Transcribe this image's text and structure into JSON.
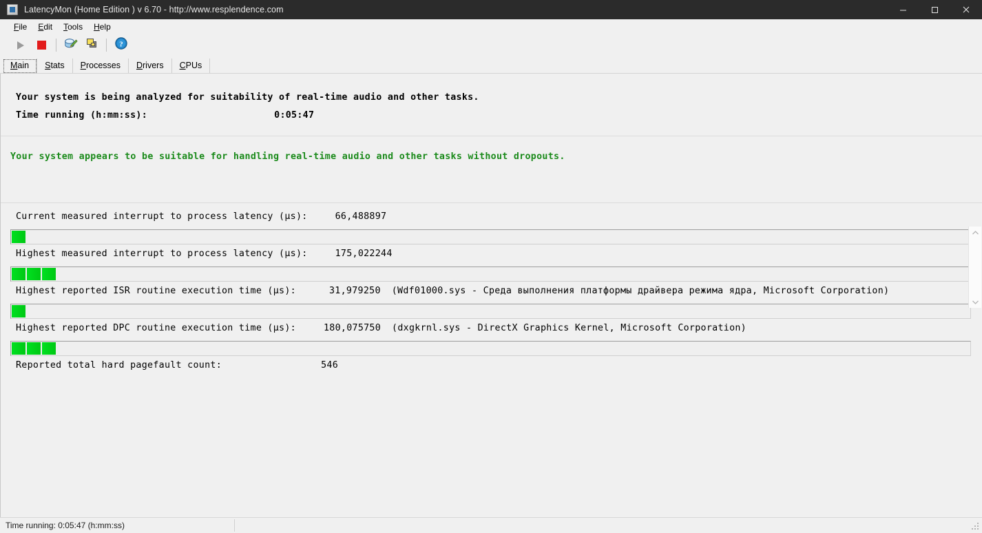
{
  "window": {
    "title": "LatencyMon  (Home Edition )  v 6.70 - http://www.resplendence.com",
    "icon": "app-icon",
    "minimize": "minimize-icon",
    "maximize": "maximize-icon",
    "close": "close-icon"
  },
  "menu": [
    {
      "label": "File",
      "accel": "F"
    },
    {
      "label": "Edit",
      "accel": "E"
    },
    {
      "label": "Tools",
      "accel": "T"
    },
    {
      "label": "Help",
      "accel": "H"
    }
  ],
  "toolbar": [
    {
      "name": "start-monitoring-button",
      "icon": "play-icon",
      "disabled": true
    },
    {
      "name": "stop-monitoring-button",
      "icon": "stop-icon",
      "disabled": false
    },
    {
      "name": "report-button",
      "icon": "report-pencil-icon",
      "disabled": false
    },
    {
      "name": "copy-button",
      "icon": "copy-windows-icon",
      "disabled": false
    },
    {
      "name": "help-button",
      "icon": "help-question-icon",
      "disabled": false
    }
  ],
  "tabs": [
    {
      "label": "Main",
      "accel": "M",
      "selected": true
    },
    {
      "label": "Stats",
      "accel": "S",
      "selected": false
    },
    {
      "label": "Processes",
      "accel": "P",
      "selected": false
    },
    {
      "label": "Drivers",
      "accel": "D",
      "selected": false
    },
    {
      "label": "CPUs",
      "accel": "C",
      "selected": false
    }
  ],
  "header": {
    "analysis_line": "Your system is being analyzed for suitability of real-time audio and other tasks.",
    "time_running_label": "Time running (h:mm:ss):",
    "time_running_value": "0:05:47"
  },
  "status": {
    "verdict": "Your system appears to be suitable for handling real-time audio and other tasks without dropouts.",
    "verdict_color": "#1a8a1a",
    "scroll_up": "chevron-up-icon",
    "scroll_down": "chevron-down-icon"
  },
  "metrics": [
    {
      "name": "current-interrupt-to-process-latency",
      "label": "Current measured interrupt to process latency (µs):",
      "value": "66,488897",
      "extra": "",
      "segments": 1
    },
    {
      "name": "highest-interrupt-to-process-latency",
      "label": "Highest measured interrupt to process latency (µs):",
      "value": "175,022244",
      "extra": "",
      "segments": 3
    },
    {
      "name": "highest-isr-routine-execution-time",
      "label": "Highest reported ISR routine execution time (µs):",
      "value": "31,979250",
      "extra": "(Wdf01000.sys - Среда выполнения платформы драйвера режима ядра, Microsoft Corporation)",
      "segments": 1
    },
    {
      "name": "highest-dpc-routine-execution-time",
      "label": "Highest reported DPC routine execution time (µs):",
      "value": "180,075750",
      "extra": "(dxgkrnl.sys - DirectX Graphics Kernel, Microsoft Corporation)",
      "segments": 3
    },
    {
      "name": "reported-total-hard-pagefault-count",
      "label": "Reported total hard pagefault count:",
      "value": "546",
      "extra": "",
      "segments": 0
    }
  ],
  "statusbar": {
    "text": "Time running: 0:05:47  (h:mm:ss)"
  }
}
